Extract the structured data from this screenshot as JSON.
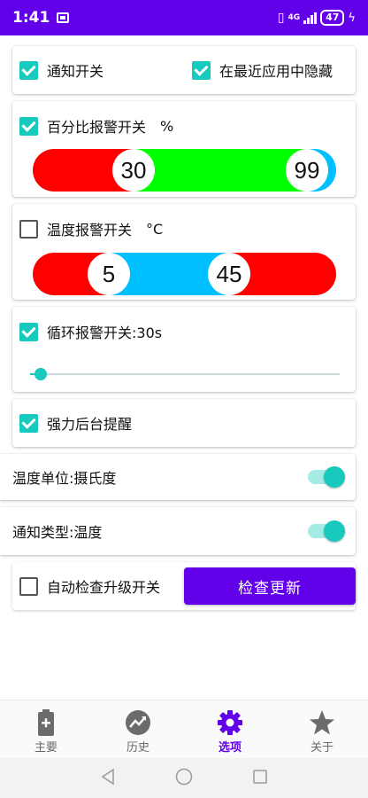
{
  "status_bar": {
    "time": "1:41",
    "network": "4G",
    "battery": "47"
  },
  "notify_card": {
    "notify_switch": {
      "label": "通知开关",
      "checked": true
    },
    "hide_recents": {
      "label": "在最近应用中隐藏",
      "checked": true
    }
  },
  "percent_alarm": {
    "label": "百分比报警开关",
    "unit": "%",
    "checked": true,
    "range": {
      "low": "30",
      "high": "99",
      "min": 0,
      "max": 100
    },
    "colors": {
      "low": "#ff0000",
      "mid": "#00ff00",
      "high": "#00bfff"
    }
  },
  "temp_alarm": {
    "label": "温度报警开关",
    "unit": "°C",
    "checked": false,
    "range": {
      "low": "5",
      "high": "45",
      "min": -10,
      "max": 60
    },
    "colors": {
      "low": "#ff0000",
      "mid": "#00bfff",
      "high": "#ff0000"
    }
  },
  "loop_alarm": {
    "label": "循环报警开关:30s",
    "checked": true,
    "slider_value": 0.04
  },
  "foreground": {
    "label": "强力后台提醒",
    "checked": true
  },
  "temp_unit": {
    "label": "温度单位:摄氏度",
    "on": true
  },
  "notify_type": {
    "label": "通知类型:温度",
    "on": true
  },
  "update": {
    "label": "自动检查升级开关",
    "checked": false,
    "button": "检查更新"
  },
  "bottom_nav": {
    "items": [
      {
        "label": "主要",
        "icon": "battery-plus-icon",
        "active": false
      },
      {
        "label": "历史",
        "icon": "chart-trend-icon",
        "active": false
      },
      {
        "label": "选项",
        "icon": "gear-icon",
        "active": true
      },
      {
        "label": "关于",
        "icon": "star-icon",
        "active": false
      }
    ]
  },
  "accent": "#18c9bd",
  "primary": "#6200ea"
}
